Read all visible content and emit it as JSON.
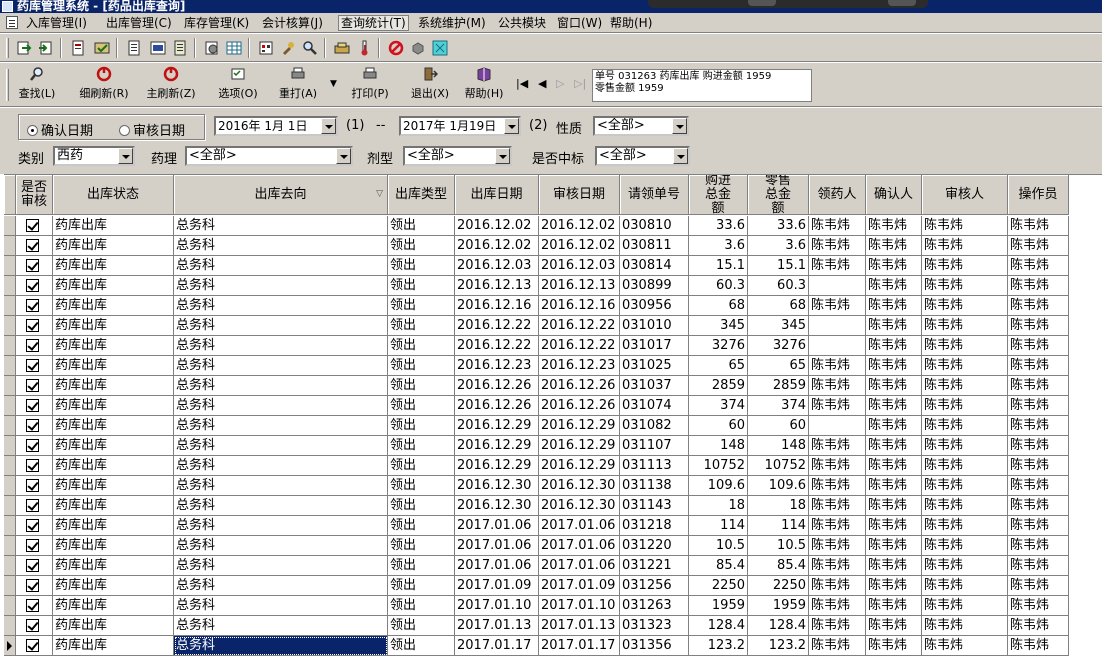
{
  "window": {
    "title": "药库管理系统 - [药品出库查询]"
  },
  "menu": [
    {
      "label": "入库管理(I)",
      "active": false
    },
    {
      "label": "出库管理(C)",
      "active": false
    },
    {
      "label": "库存管理(K)",
      "active": false
    },
    {
      "label": "会计核算(J)",
      "active": false
    },
    {
      "label": "查询统计(T)",
      "active": true
    },
    {
      "label": "系统维护(M)",
      "active": false
    },
    {
      "label": "公共模块",
      "active": false
    },
    {
      "label": "窗口(W)",
      "active": false
    },
    {
      "label": "帮助(H)",
      "active": false
    }
  ],
  "icon_toolbar": [
    "open-icon",
    "import-icon",
    "print-doc-icon",
    "email-icon",
    "copy-icon",
    "image-icon",
    "notepad-icon",
    "settings-doc-icon",
    "grid-icon",
    "calendar-icon",
    "brush-icon",
    "search-icon",
    "money-icon",
    "thermometer-icon",
    "stop-icon",
    "shape-icon",
    "cyan-box-icon"
  ],
  "toolbar": {
    "buttons": [
      {
        "label": "查找(L)",
        "icon": "search-icon"
      },
      {
        "label": "细刷新(R)",
        "icon": "refresh-icon"
      },
      {
        "label": "主刷新(Z)",
        "icon": "refresh-icon"
      },
      {
        "label": "选项(O)",
        "icon": "options-icon"
      },
      {
        "label": "重打(A)",
        "icon": "reprint-icon"
      },
      {
        "label": "打印(P)",
        "icon": "print-icon"
      },
      {
        "label": "退出(X)",
        "icon": "exit-icon"
      },
      {
        "label": "帮助(H)",
        "icon": "help-book-icon"
      }
    ],
    "nav": [
      "|◀",
      "◀",
      "▷",
      "▷|"
    ],
    "info_line1": "单号 031263 药库出库 购进金额 1959",
    "info_line2": "零售金额 1959"
  },
  "filters": {
    "radio_confirm": "确认日期",
    "radio_audit": "审核日期",
    "date_from": "2016年 1月 1日",
    "label_1": "(1)",
    "dash": "--",
    "date_to": "2017年 1月19日",
    "label_2": "(2)",
    "nature_label": "性质",
    "nature_value": "<全部>",
    "category_label": "类别",
    "category_value": "西药",
    "pharm_label": "药理",
    "pharm_value": "<全部>",
    "dosage_label": "剂型",
    "dosage_value": "<全部>",
    "bid_label": "是否中标",
    "bid_value": "<全部>"
  },
  "grid": {
    "headers": {
      "audited": "是否审核",
      "status": "出库状态",
      "destination": "出库去向",
      "type": "出库类型",
      "out_date": "出库日期",
      "audit_date": "审核日期",
      "req_no": "请领单号",
      "purchase_total": "购进总金额",
      "retail_total": "零售总金额",
      "receiver": "领药人",
      "confirmer": "确认人",
      "auditor": "审核人",
      "operator": "操作员"
    },
    "rows": [
      {
        "status": "药库出库",
        "dest": "总务科",
        "type": "领出",
        "out_date": "2016.12.02",
        "audit_date": "2016.12.02",
        "req_no": "030810",
        "purchase": "33.6",
        "retail": "33.6",
        "receiver": "陈韦炜",
        "confirmer": "陈韦炜",
        "auditor": "陈韦炜",
        "operator": "陈韦炜"
      },
      {
        "status": "药库出库",
        "dest": "总务科",
        "type": "领出",
        "out_date": "2016.12.02",
        "audit_date": "2016.12.02",
        "req_no": "030811",
        "purchase": "3.6",
        "retail": "3.6",
        "receiver": "陈韦炜",
        "confirmer": "陈韦炜",
        "auditor": "陈韦炜",
        "operator": "陈韦炜"
      },
      {
        "status": "药库出库",
        "dest": "总务科",
        "type": "领出",
        "out_date": "2016.12.03",
        "audit_date": "2016.12.03",
        "req_no": "030814",
        "purchase": "15.1",
        "retail": "15.1",
        "receiver": "陈韦炜",
        "confirmer": "陈韦炜",
        "auditor": "陈韦炜",
        "operator": "陈韦炜"
      },
      {
        "status": "药库出库",
        "dest": "总务科",
        "type": "领出",
        "out_date": "2016.12.13",
        "audit_date": "2016.12.13",
        "req_no": "030899",
        "purchase": "60.3",
        "retail": "60.3",
        "receiver": "",
        "confirmer": "陈韦炜",
        "auditor": "陈韦炜",
        "operator": "陈韦炜"
      },
      {
        "status": "药库出库",
        "dest": "总务科",
        "type": "领出",
        "out_date": "2016.12.16",
        "audit_date": "2016.12.16",
        "req_no": "030956",
        "purchase": "68",
        "retail": "68",
        "receiver": "陈韦炜",
        "confirmer": "陈韦炜",
        "auditor": "陈韦炜",
        "operator": "陈韦炜"
      },
      {
        "status": "药库出库",
        "dest": "总务科",
        "type": "领出",
        "out_date": "2016.12.22",
        "audit_date": "2016.12.22",
        "req_no": "031010",
        "purchase": "345",
        "retail": "345",
        "receiver": "",
        "confirmer": "陈韦炜",
        "auditor": "陈韦炜",
        "operator": "陈韦炜"
      },
      {
        "status": "药库出库",
        "dest": "总务科",
        "type": "领出",
        "out_date": "2016.12.22",
        "audit_date": "2016.12.22",
        "req_no": "031017",
        "purchase": "3276",
        "retail": "3276",
        "receiver": "",
        "confirmer": "陈韦炜",
        "auditor": "陈韦炜",
        "operator": "陈韦炜"
      },
      {
        "status": "药库出库",
        "dest": "总务科",
        "type": "领出",
        "out_date": "2016.12.23",
        "audit_date": "2016.12.23",
        "req_no": "031025",
        "purchase": "65",
        "retail": "65",
        "receiver": "陈韦炜",
        "confirmer": "陈韦炜",
        "auditor": "陈韦炜",
        "operator": "陈韦炜"
      },
      {
        "status": "药库出库",
        "dest": "总务科",
        "type": "领出",
        "out_date": "2016.12.26",
        "audit_date": "2016.12.26",
        "req_no": "031037",
        "purchase": "2859",
        "retail": "2859",
        "receiver": "陈韦炜",
        "confirmer": "陈韦炜",
        "auditor": "陈韦炜",
        "operator": "陈韦炜"
      },
      {
        "status": "药库出库",
        "dest": "总务科",
        "type": "领出",
        "out_date": "2016.12.26",
        "audit_date": "2016.12.26",
        "req_no": "031074",
        "purchase": "374",
        "retail": "374",
        "receiver": "陈韦炜",
        "confirmer": "陈韦炜",
        "auditor": "陈韦炜",
        "operator": "陈韦炜"
      },
      {
        "status": "药库出库",
        "dest": "总务科",
        "type": "领出",
        "out_date": "2016.12.29",
        "audit_date": "2016.12.29",
        "req_no": "031082",
        "purchase": "60",
        "retail": "60",
        "receiver": "",
        "confirmer": "陈韦炜",
        "auditor": "陈韦炜",
        "operator": "陈韦炜"
      },
      {
        "status": "药库出库",
        "dest": "总务科",
        "type": "领出",
        "out_date": "2016.12.29",
        "audit_date": "2016.12.29",
        "req_no": "031107",
        "purchase": "148",
        "retail": "148",
        "receiver": "陈韦炜",
        "confirmer": "陈韦炜",
        "auditor": "陈韦炜",
        "operator": "陈韦炜"
      },
      {
        "status": "药库出库",
        "dest": "总务科",
        "type": "领出",
        "out_date": "2016.12.29",
        "audit_date": "2016.12.29",
        "req_no": "031113",
        "purchase": "10752",
        "retail": "10752",
        "receiver": "陈韦炜",
        "confirmer": "陈韦炜",
        "auditor": "陈韦炜",
        "operator": "陈韦炜"
      },
      {
        "status": "药库出库",
        "dest": "总务科",
        "type": "领出",
        "out_date": "2016.12.30",
        "audit_date": "2016.12.30",
        "req_no": "031138",
        "purchase": "109.6",
        "retail": "109.6",
        "receiver": "陈韦炜",
        "confirmer": "陈韦炜",
        "auditor": "陈韦炜",
        "operator": "陈韦炜"
      },
      {
        "status": "药库出库",
        "dest": "总务科",
        "type": "领出",
        "out_date": "2016.12.30",
        "audit_date": "2016.12.30",
        "req_no": "031143",
        "purchase": "18",
        "retail": "18",
        "receiver": "陈韦炜",
        "confirmer": "陈韦炜",
        "auditor": "陈韦炜",
        "operator": "陈韦炜"
      },
      {
        "status": "药库出库",
        "dest": "总务科",
        "type": "领出",
        "out_date": "2017.01.06",
        "audit_date": "2017.01.06",
        "req_no": "031218",
        "purchase": "114",
        "retail": "114",
        "receiver": "陈韦炜",
        "confirmer": "陈韦炜",
        "auditor": "陈韦炜",
        "operator": "陈韦炜"
      },
      {
        "status": "药库出库",
        "dest": "总务科",
        "type": "领出",
        "out_date": "2017.01.06",
        "audit_date": "2017.01.06",
        "req_no": "031220",
        "purchase": "10.5",
        "retail": "10.5",
        "receiver": "陈韦炜",
        "confirmer": "陈韦炜",
        "auditor": "陈韦炜",
        "operator": "陈韦炜"
      },
      {
        "status": "药库出库",
        "dest": "总务科",
        "type": "领出",
        "out_date": "2017.01.06",
        "audit_date": "2017.01.06",
        "req_no": "031221",
        "purchase": "85.4",
        "retail": "85.4",
        "receiver": "陈韦炜",
        "confirmer": "陈韦炜",
        "auditor": "陈韦炜",
        "operator": "陈韦炜"
      },
      {
        "status": "药库出库",
        "dest": "总务科",
        "type": "领出",
        "out_date": "2017.01.09",
        "audit_date": "2017.01.09",
        "req_no": "031256",
        "purchase": "2250",
        "retail": "2250",
        "receiver": "陈韦炜",
        "confirmer": "陈韦炜",
        "auditor": "陈韦炜",
        "operator": "陈韦炜"
      },
      {
        "status": "药库出库",
        "dest": "总务科",
        "type": "领出",
        "out_date": "2017.01.10",
        "audit_date": "2017.01.10",
        "req_no": "031263",
        "purchase": "1959",
        "retail": "1959",
        "receiver": "陈韦炜",
        "confirmer": "陈韦炜",
        "auditor": "陈韦炜",
        "operator": "陈韦炜"
      },
      {
        "status": "药库出库",
        "dest": "总务科",
        "type": "领出",
        "out_date": "2017.01.13",
        "audit_date": "2017.01.13",
        "req_no": "031323",
        "purchase": "128.4",
        "retail": "128.4",
        "receiver": "陈韦炜",
        "confirmer": "陈韦炜",
        "auditor": "陈韦炜",
        "operator": "陈韦炜"
      },
      {
        "status": "药库出库",
        "dest": "总务科",
        "type": "领出",
        "out_date": "2017.01.17",
        "audit_date": "2017.01.17",
        "req_no": "031356",
        "purchase": "123.2",
        "retail": "123.2",
        "receiver": "陈韦炜",
        "confirmer": "陈韦炜",
        "auditor": "陈韦炜",
        "operator": "陈韦炜"
      }
    ],
    "current_row": 21
  }
}
